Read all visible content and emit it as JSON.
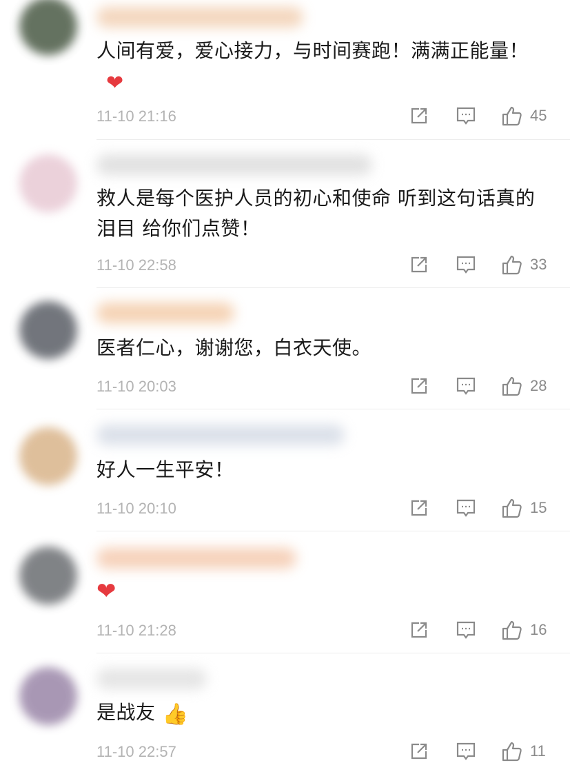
{
  "comments": [
    {
      "text": "人间有爱，爱心接力，与时间赛跑！满满正能量！",
      "emoji": "heart",
      "time": "11-10 21:16",
      "likes": "45",
      "avatar_color": "#4a5a45",
      "name_color": "#f0c9a8"
    },
    {
      "text": "救人是每个医护人员的初心和使命 听到这句话真的泪目 给你们点赞！",
      "emoji": "",
      "time": "11-10 22:58",
      "likes": "33",
      "avatar_color": "#e8c9d4",
      "name_color": "#d7d7d7"
    },
    {
      "text": "医者仁心，谢谢您，白衣天使。",
      "emoji": "",
      "time": "11-10 20:03",
      "likes": "28",
      "avatar_color": "#5a5e66",
      "name_color": "#f2c49c"
    },
    {
      "text": "好人一生平安！",
      "emoji": "",
      "time": "11-10 20:10",
      "likes": "15",
      "avatar_color": "#d9b48a",
      "name_color": "#cfd6e2"
    },
    {
      "text": "",
      "emoji": "heart",
      "time": "11-10 21:28",
      "likes": "16",
      "avatar_color": "#6b6e72",
      "name_color": "#f3c2a3"
    },
    {
      "text": "是战友",
      "emoji": "thumbs-up",
      "time": "11-10 22:57",
      "likes": "11",
      "avatar_color": "#9a86a8",
      "name_color": "#dcdcdc"
    }
  ]
}
